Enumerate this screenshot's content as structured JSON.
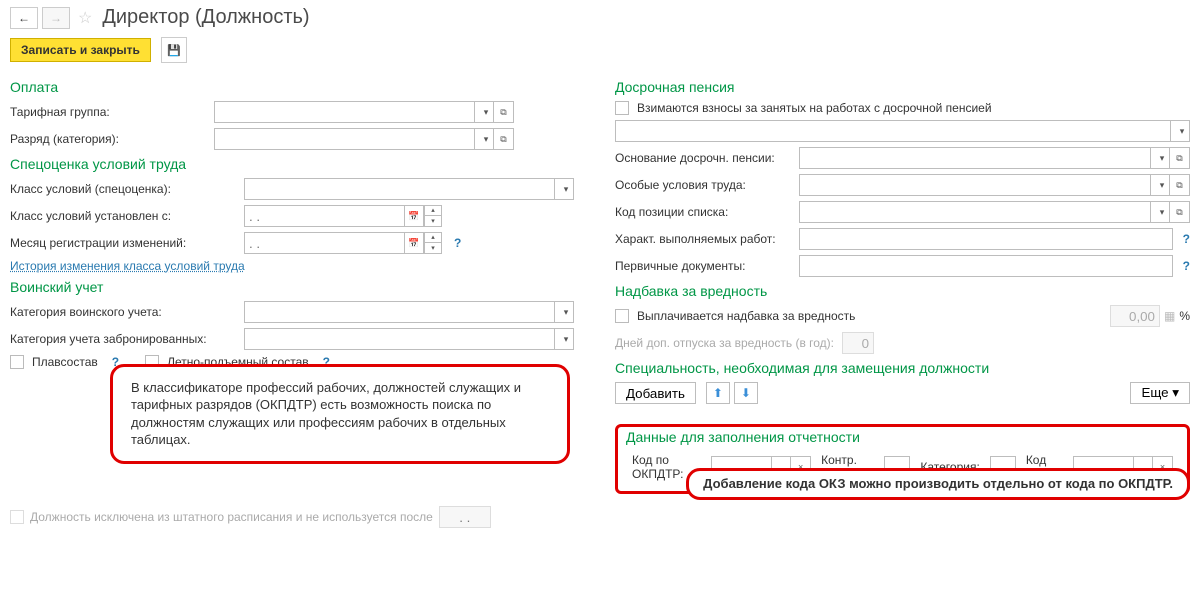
{
  "header": {
    "title": "Директор (Должность)"
  },
  "actions": {
    "save_close": "Записать и закрыть"
  },
  "sections": {
    "pay": "Оплата",
    "spec": "Спецоценка условий труда",
    "military": "Воинский учет",
    "pension": "Досрочная пенсия",
    "hazard": "Надбавка за вредность",
    "specialty": "Специальность, необходимая для замещения должности",
    "report": "Данные для заполнения отчетности"
  },
  "pay": {
    "tariff_label": "Тарифная группа:",
    "rank_label": "Разряд (категория):"
  },
  "spec": {
    "class_label": "Класс условий (спецоценка):",
    "class_date_label": "Класс условий установлен с:",
    "month_label": "Месяц регистрации изменений:",
    "date_placeholder": ". .",
    "history_link": "История изменения класса условий труда"
  },
  "military": {
    "cat_label": "Категория воинского учета:",
    "booked_label": "Категория учета забронированных:",
    "float_label": "Плавсостав",
    "air_label": "Летно-подъемный состав"
  },
  "pension": {
    "chk_label": "Взимаются взносы за занятых на работах с досрочной пенсией",
    "basis": "Основание досрочн. пенсии:",
    "cond": "Особые условия труда:",
    "code": "Код позиции списка:",
    "work": "Характ. выполняемых работ:",
    "docs": "Первичные документы:"
  },
  "hazard": {
    "chk_label": "Выплачивается надбавка за вредность",
    "pct_val": "0,00",
    "pct": "%",
    "days_label": "Дней доп. отпуска за вредность (в год):",
    "days_val": "0"
  },
  "specialty": {
    "add": "Добавить",
    "more": "Еще"
  },
  "report": {
    "okpdtr": "Код по ОКПДТР:",
    "check_num": "Контр. число:",
    "category": "Категория:",
    "okz": "Код ОКЗ:",
    "dots": "..."
  },
  "callouts": {
    "left": "В классификаторе профессий рабочих, должностей служащих и тарифных разрядов (ОКПДТР) есть возможность поиска по должностям служащих или профессиям рабочих в отдельных таблицах.",
    "right": "Добавление кода ОКЗ можно производить отдельно от кода по ОКПДТР."
  },
  "bottom": {
    "excluded_label": "Должность исключена из штатного расписания и не используется после",
    "date_placeholder": ". ."
  }
}
